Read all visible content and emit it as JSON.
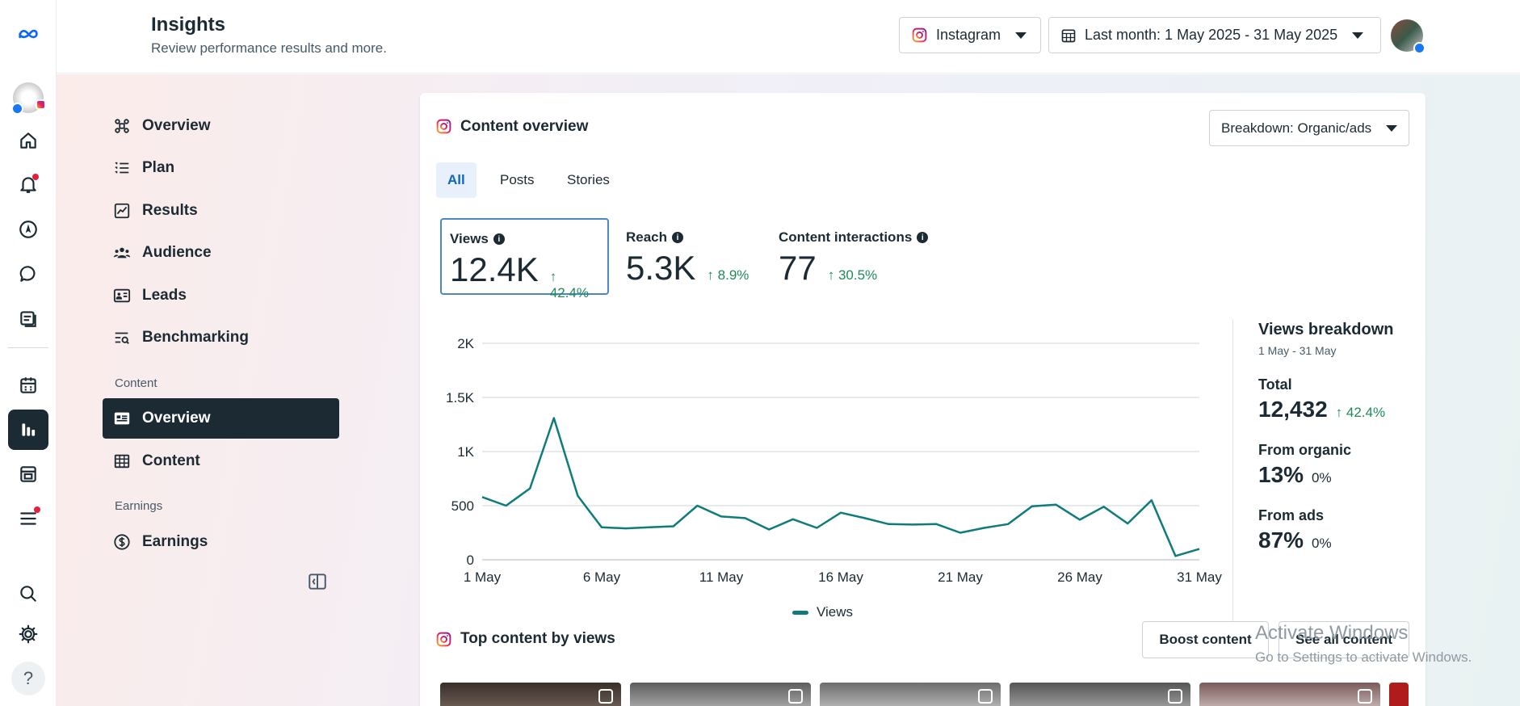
{
  "header": {
    "title": "Insights",
    "subtitle": "Review performance results and more.",
    "platform_label": "Instagram",
    "date_range_label": "Last month: 1 May 2025 - 31 May 2025"
  },
  "sidebar": {
    "items": [
      {
        "label": "Overview",
        "icon": "overview-icon"
      },
      {
        "label": "Plan",
        "icon": "list-icon"
      },
      {
        "label": "Results",
        "icon": "line-chart-icon"
      },
      {
        "label": "Audience",
        "icon": "people-icon"
      },
      {
        "label": "Leads",
        "icon": "contact-card-icon"
      },
      {
        "label": "Benchmarking",
        "icon": "benchmark-icon"
      }
    ],
    "content_section": "Content",
    "content_items": [
      {
        "label": "Overview",
        "icon": "content-overview-icon",
        "active": true
      },
      {
        "label": "Content",
        "icon": "table-icon"
      }
    ],
    "earnings_section": "Earnings",
    "earnings_items": [
      {
        "label": "Earnings",
        "icon": "dollar-icon"
      }
    ]
  },
  "card": {
    "title": "Content overview",
    "breakdown_label": "Breakdown: Organic/ads",
    "tabs": [
      "All",
      "Posts",
      "Stories"
    ],
    "active_tab": "All",
    "metrics": [
      {
        "label": "Views",
        "value": "12.4K",
        "delta": "42.4%"
      },
      {
        "label": "Reach",
        "value": "5.3K",
        "delta": "8.9%"
      },
      {
        "label": "Content interactions",
        "value": "77",
        "delta": "30.5%"
      }
    ],
    "breakdown_panel": {
      "title": "Views breakdown",
      "range": "1 May - 31 May",
      "total_label": "Total",
      "total_value": "12,432",
      "total_delta": "42.4%",
      "organic_label": "From organic",
      "organic_value": "13%",
      "organic_delta": "0%",
      "ads_label": "From ads",
      "ads_value": "87%",
      "ads_delta": "0%"
    },
    "legend_label": "Views",
    "top_content_title": "Top content by views",
    "boost_button": "Boost content",
    "see_all_button": "See all content"
  },
  "watermark": {
    "line1": "Activate Windows",
    "line2": "Go to Settings to activate Windows."
  },
  "colors": {
    "series": "#0f7b7b",
    "accent": "#0a66c2",
    "positive": "#1e8b57",
    "nav_active": "#1c2b33"
  },
  "chart_data": {
    "type": "line",
    "x": [
      "1 May",
      "2 May",
      "3 May",
      "4 May",
      "5 May",
      "6 May",
      "7 May",
      "8 May",
      "9 May",
      "10 May",
      "11 May",
      "12 May",
      "13 May",
      "14 May",
      "15 May",
      "16 May",
      "17 May",
      "18 May",
      "19 May",
      "20 May",
      "21 May",
      "22 May",
      "23 May",
      "24 May",
      "25 May",
      "26 May",
      "27 May",
      "28 May",
      "29 May",
      "30 May",
      "31 May"
    ],
    "series": [
      {
        "name": "Views",
        "values": [
          580,
          500,
          660,
          1310,
          590,
          300,
          290,
          300,
          310,
          500,
          400,
          385,
          280,
          375,
          295,
          435,
          385,
          330,
          325,
          330,
          250,
          295,
          330,
          495,
          510,
          370,
          490,
          335,
          550,
          35,
          100
        ]
      }
    ],
    "tick_labels_x": [
      "1 May",
      "6 May",
      "11 May",
      "16 May",
      "21 May",
      "26 May",
      "31 May"
    ],
    "tick_labels_y": [
      "0",
      "500",
      "1K",
      "1.5K",
      "2K"
    ],
    "ylim": [
      0,
      2000
    ],
    "grid": true,
    "legend": "bottom"
  }
}
